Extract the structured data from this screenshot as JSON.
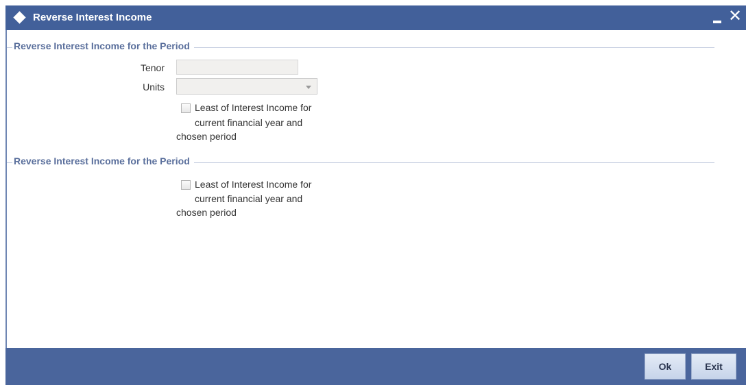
{
  "window": {
    "title": "Reverse Interest Income",
    "minimize_label": "",
    "close_label": "✕"
  },
  "section1": {
    "header": "Reverse Interest Income for the Period",
    "tenor_label": "Tenor",
    "tenor_value": "",
    "units_label": "Units",
    "units_value": "",
    "checkbox_line1": "Least of Interest Income for",
    "checkbox_line2": "current financial year and",
    "checkbox_line3": "chosen period",
    "checkbox_checked": false
  },
  "section2": {
    "header": "Reverse Interest Income for the Period",
    "checkbox_line1": "Least of Interest Income for",
    "checkbox_line2": "current financial year and",
    "checkbox_line3": "chosen period",
    "checkbox_checked": false
  },
  "footer": {
    "ok_label": "Ok",
    "exit_label": "Exit"
  },
  "colors": {
    "titlebar": "#42609a",
    "footer": "#4a659c",
    "section_header_text": "#5a6f9c"
  },
  "icons": {
    "title_icon": "diamond-icon",
    "minimize": "minimize-icon",
    "close": "close-icon",
    "dropdown": "chevron-down-icon"
  }
}
